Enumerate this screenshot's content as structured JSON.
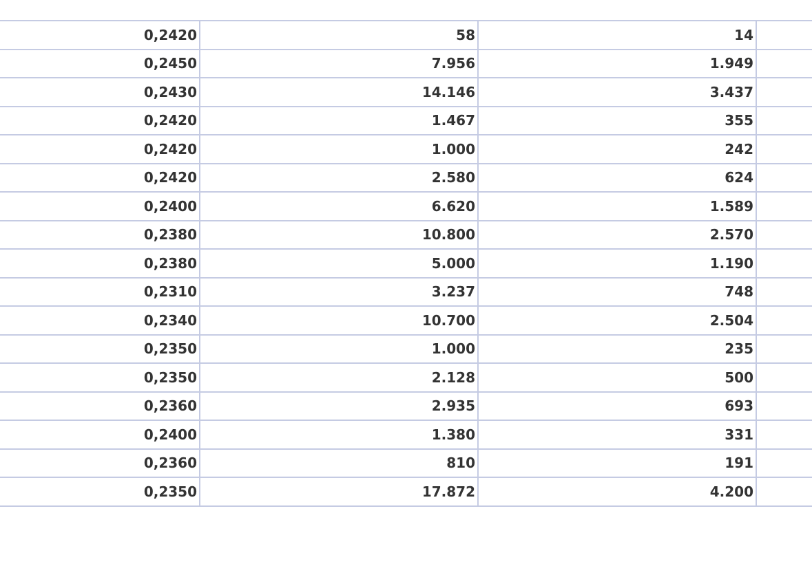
{
  "table": {
    "rows": [
      {
        "price": "0,2420",
        "volume": "58",
        "value": "14"
      },
      {
        "price": "0,2450",
        "volume": "7.956",
        "value": "1.949"
      },
      {
        "price": "0,2430",
        "volume": "14.146",
        "value": "3.437"
      },
      {
        "price": "0,2420",
        "volume": "1.467",
        "value": "355"
      },
      {
        "price": "0,2420",
        "volume": "1.000",
        "value": "242"
      },
      {
        "price": "0,2420",
        "volume": "2.580",
        "value": "624"
      },
      {
        "price": "0,2400",
        "volume": "6.620",
        "value": "1.589"
      },
      {
        "price": "0,2380",
        "volume": "10.800",
        "value": "2.570"
      },
      {
        "price": "0,2380",
        "volume": "5.000",
        "value": "1.190"
      },
      {
        "price": "0,2310",
        "volume": "3.237",
        "value": "748"
      },
      {
        "price": "0,2340",
        "volume": "10.700",
        "value": "2.504"
      },
      {
        "price": "0,2350",
        "volume": "1.000",
        "value": "235"
      },
      {
        "price": "0,2350",
        "volume": "2.128",
        "value": "500"
      },
      {
        "price": "0,2360",
        "volume": "2.935",
        "value": "693"
      },
      {
        "price": "0,2400",
        "volume": "1.380",
        "value": "331"
      },
      {
        "price": "0,2360",
        "volume": "810",
        "value": "191"
      },
      {
        "price": "0,2350",
        "volume": "17.872",
        "value": "4.200"
      }
    ]
  },
  "colors": {
    "grid_line": "#c5cbe3",
    "text": "#333333",
    "background": "#ffffff"
  }
}
